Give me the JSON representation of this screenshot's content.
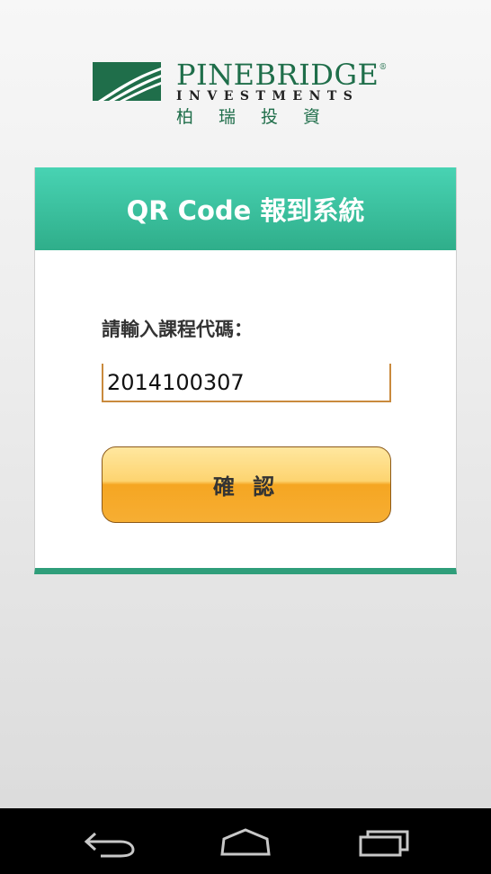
{
  "logo": {
    "name": "PINEBRIDGE",
    "tm": "®",
    "subtitle": "INVESTMENTS",
    "chinese": "柏瑞投資"
  },
  "card": {
    "title": "QR Code 報到系統",
    "field_label": "請輸入課程代碼：",
    "course_code_value": "2014100307",
    "confirm_label": "確 認"
  },
  "navbar": {
    "icons": [
      "back-icon",
      "home-icon",
      "recent-apps-icon"
    ]
  },
  "colors": {
    "brand_green": "#1f6e4a",
    "header_teal": "#2fae8a",
    "button_orange": "#f5a622"
  }
}
